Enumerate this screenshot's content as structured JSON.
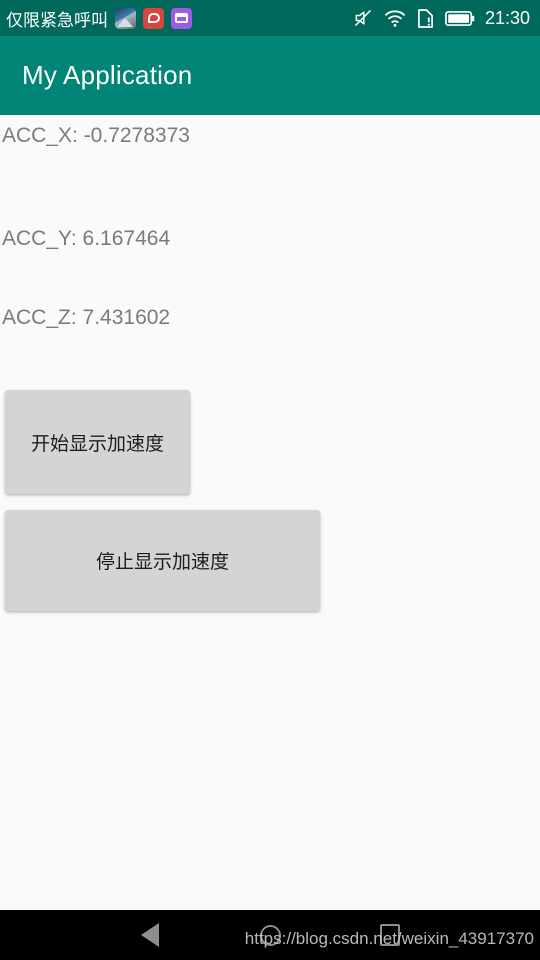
{
  "status_bar": {
    "carrier": "仅限紧急呼叫",
    "clock": "21:30",
    "background": "#00695C",
    "notification_icons": [
      {
        "name": "photo-app-icon",
        "color": "#3F7FB5"
      },
      {
        "name": "red-cloud-app-icon",
        "color": "#D9453C"
      },
      {
        "name": "purple-window-app-icon",
        "color": "#9B5DE5"
      }
    ],
    "system_icons": [
      {
        "name": "mute-icon"
      },
      {
        "name": "wifi-icon"
      },
      {
        "name": "sim-alert-icon"
      },
      {
        "name": "battery-icon"
      }
    ]
  },
  "app_bar": {
    "title": "My Application",
    "background": "#008577"
  },
  "main": {
    "background": "#FAFAFA",
    "readouts": [
      {
        "label": "acc-x",
        "text": "ACC_X: -0.7278373"
      },
      {
        "label": "acc-y",
        "text": "ACC_Y: 6.167464"
      },
      {
        "label": "acc-z",
        "text": "ACC_Z: 7.431602"
      }
    ],
    "buttons": {
      "start": "开始显示加速度",
      "stop": "停止显示加速度",
      "background": "#D4D4D4"
    }
  },
  "nav_bar": {
    "background": "#000000",
    "items": [
      {
        "name": "back-button"
      },
      {
        "name": "home-button"
      },
      {
        "name": "recents-button"
      }
    ]
  },
  "watermark": {
    "text": "https://blog.csdn.net/weixin_43917370"
  }
}
